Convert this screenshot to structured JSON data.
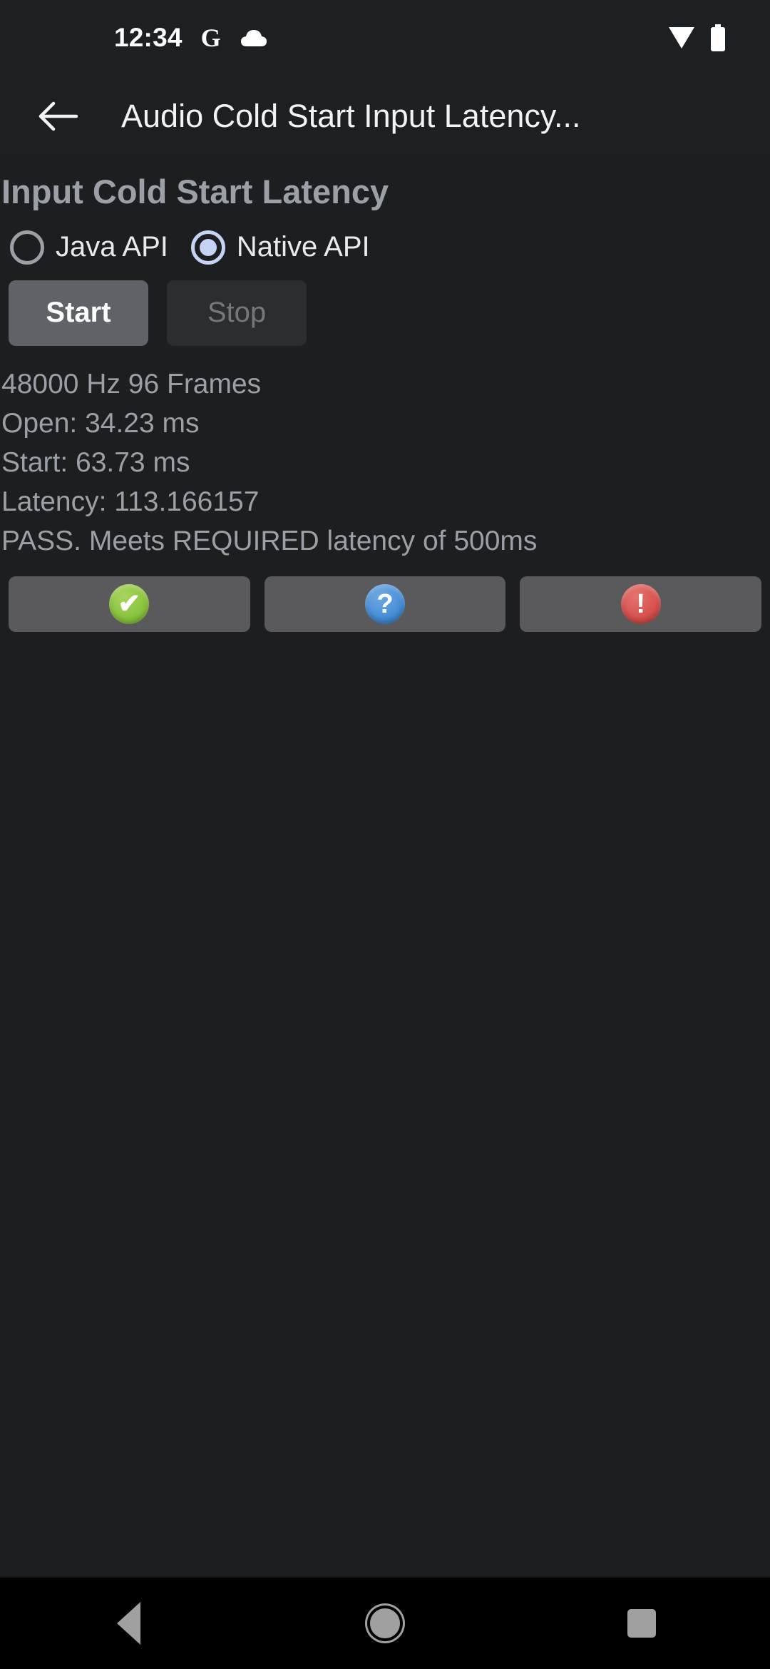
{
  "statusbar": {
    "clock": "12:34",
    "google_icon": "G",
    "icons": [
      "google-icon",
      "cloud-icon",
      "wifi-icon",
      "battery-icon"
    ]
  },
  "appbar": {
    "back_icon": "back-arrow-icon",
    "title": "Audio Cold Start Input Latency..."
  },
  "main": {
    "section_title": "Input Cold Start Latency",
    "api_options": [
      {
        "label": "Java API",
        "selected": false
      },
      {
        "label": "Native API",
        "selected": true
      }
    ],
    "buttons": {
      "start": {
        "label": "Start",
        "enabled": true
      },
      "stop": {
        "label": "Stop",
        "enabled": false
      }
    },
    "readout": [
      "48000 Hz 96 Frames",
      "Open: 34.23 ms",
      "Start: 63.73 ms",
      "Latency: 113.166157",
      "PASS. Meets REQUIRED latency of 500ms"
    ],
    "result_buttons": [
      {
        "name": "pass-button",
        "icon": "check-circle-icon",
        "glyph": "✔",
        "color": "#8CC63F"
      },
      {
        "name": "info-button",
        "icon": "question-circle-icon",
        "glyph": "?",
        "color": "#4A90D9"
      },
      {
        "name": "fail-button",
        "icon": "exclamation-circle-icon",
        "glyph": "!",
        "color": "#D9534F"
      }
    ]
  },
  "navbar": {
    "back": "back-triangle-icon",
    "home": "home-circle-icon",
    "recents": "recents-square-icon"
  },
  "colors": {
    "background": "#1C1E20",
    "appbar": "#1D2023",
    "muted_text": "#9AA0A6",
    "accent_radio": "#C5D4F5",
    "button_enabled": "#5F6368"
  }
}
